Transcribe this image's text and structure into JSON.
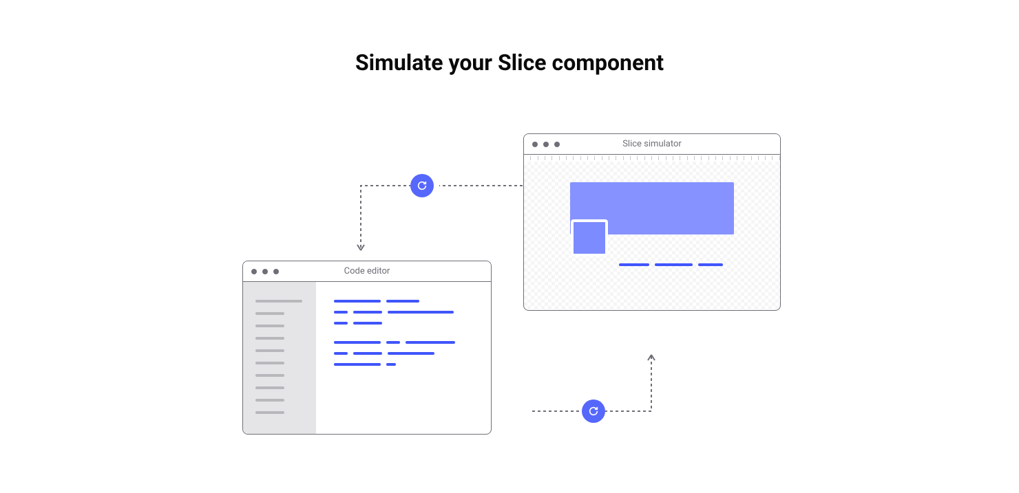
{
  "title": "Simulate your Slice component",
  "code_editor": {
    "window_title": "Code editor"
  },
  "slice_simulator": {
    "window_title": "Slice simulator"
  },
  "icons": {
    "refresh_top": "refresh-icon",
    "refresh_bottom": "refresh-icon"
  }
}
